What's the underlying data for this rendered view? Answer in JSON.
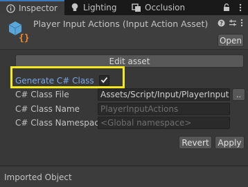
{
  "tabs": [
    {
      "label": "Inspector",
      "icon": "info-icon",
      "active": true
    },
    {
      "label": "Lighting",
      "icon": "lightbulb-icon",
      "active": false
    },
    {
      "label": "Occlusion",
      "icon": "occlusion-icon",
      "active": false
    }
  ],
  "header": {
    "title": "Player Input Actions (Input Action Asset)",
    "open_label": "Open"
  },
  "edit_asset_label": "Edit asset",
  "generate_class": {
    "label": "Generate C# Class",
    "checked": true
  },
  "fields": {
    "class_file": {
      "label": "C# Class File",
      "value": "Assets/Script/Input/PlayerInputA"
    },
    "class_name": {
      "label": "C# Class Name",
      "placeholder": "PlayerInputActions"
    },
    "class_namespace": {
      "label": "C# Class Namespace",
      "placeholder": "<Global namespace>"
    }
  },
  "browse_label": "..",
  "buttons": {
    "revert": "Revert",
    "apply": "Apply"
  },
  "footer_label": "Imported Object",
  "colors": {
    "highlight": "#f4ea1c",
    "accent": "#3a79bb",
    "link_label": "#79a8e6",
    "background": "#383838"
  }
}
